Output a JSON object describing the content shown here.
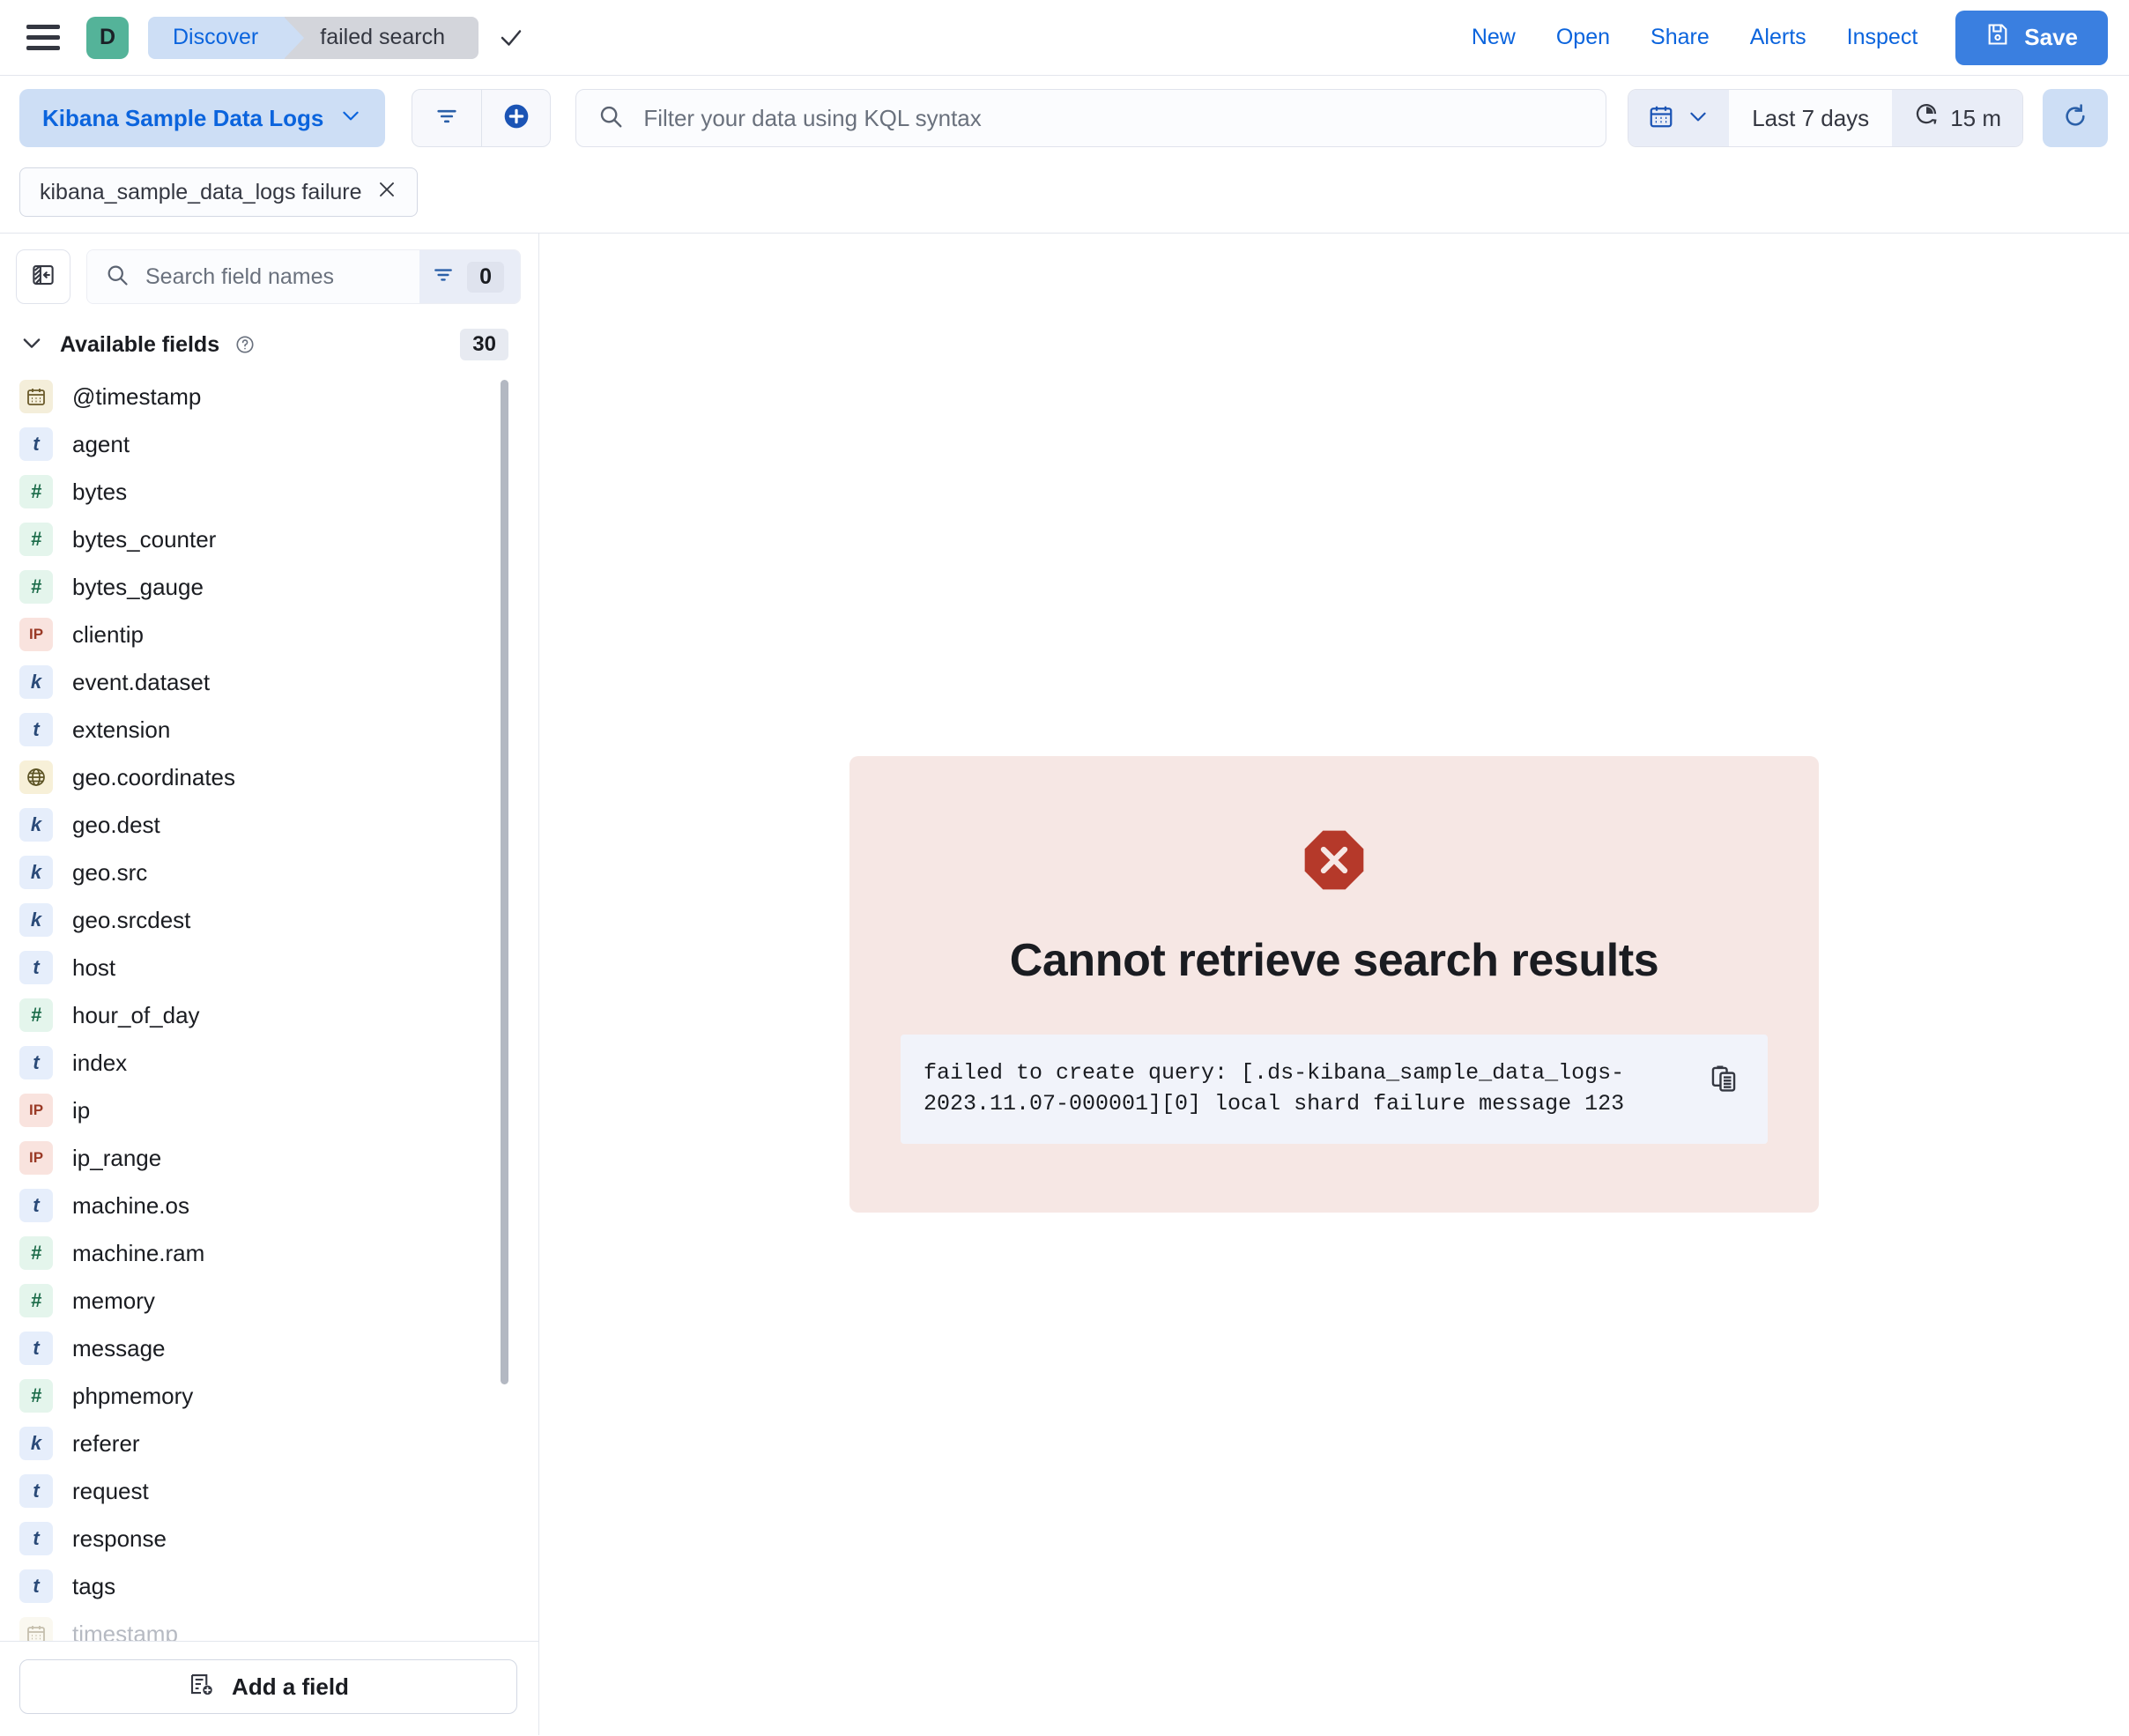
{
  "chrome": {
    "menu_icon": "hamburger-icon",
    "space_initial": "D",
    "breadcrumbs": [
      {
        "label": "Discover",
        "icon": ""
      },
      {
        "label": "failed search",
        "icon": ""
      }
    ],
    "saved_check_icon": "check-icon",
    "links": [
      "New",
      "Open",
      "Share",
      "Alerts",
      "Inspect"
    ],
    "save_label": "Save",
    "save_icon": "save-disk-icon",
    "accent_blue": "#0b64dd",
    "save_bg": "#3a7fe0",
    "space_bg": "#54b399"
  },
  "query": {
    "data_view": "Kibana Sample Data Logs",
    "data_view_chevron": "chevron-down-icon",
    "filter_icon": "filter-icon",
    "add_filter_icon": "plus-circle-icon",
    "search_icon": "search-icon",
    "kql_placeholder": "Filter your data using KQL syntax",
    "kql_value": "",
    "calendar_icon": "calendar-icon",
    "calendar_chevron": "chevron-down-icon",
    "time_range": "Last 7 days",
    "refresh_interval_icon": "clock-icon",
    "refresh_interval": "15 m",
    "refresh_icon": "refresh-icon"
  },
  "filters": [
    {
      "label": "kibana_sample_data_logs failure",
      "remove_icon": "close-icon"
    }
  ],
  "sidebar": {
    "collapse_icon": "collapse-sidebar-icon",
    "search_icon": "search-icon",
    "search_placeholder": "Search field names",
    "search_value": "",
    "field_filter_icon": "filter-icon",
    "field_filter_count": "0",
    "available_label": "Available fields",
    "available_help_icon": "help-circle-icon",
    "available_count": "30",
    "collapse_chevron": "chevron-down-icon",
    "fields": [
      {
        "name": "@timestamp",
        "type": "date",
        "glyph": "date-icon",
        "faded": false
      },
      {
        "name": "agent",
        "type": "t",
        "glyph": "t",
        "faded": false
      },
      {
        "name": "bytes",
        "type": "n",
        "glyph": "#",
        "faded": false
      },
      {
        "name": "bytes_counter",
        "type": "n",
        "glyph": "#",
        "faded": false
      },
      {
        "name": "bytes_gauge",
        "type": "n",
        "glyph": "#",
        "faded": false
      },
      {
        "name": "clientip",
        "type": "ip",
        "glyph": "IP",
        "faded": false
      },
      {
        "name": "event.dataset",
        "type": "k",
        "glyph": "k",
        "faded": false
      },
      {
        "name": "extension",
        "type": "t",
        "glyph": "t",
        "faded": false
      },
      {
        "name": "geo.coordinates",
        "type": "geo",
        "glyph": "geo-icon",
        "faded": false
      },
      {
        "name": "geo.dest",
        "type": "k",
        "glyph": "k",
        "faded": false
      },
      {
        "name": "geo.src",
        "type": "k",
        "glyph": "k",
        "faded": false
      },
      {
        "name": "geo.srcdest",
        "type": "k",
        "glyph": "k",
        "faded": false
      },
      {
        "name": "host",
        "type": "t",
        "glyph": "t",
        "faded": false
      },
      {
        "name": "hour_of_day",
        "type": "n",
        "glyph": "#",
        "faded": false
      },
      {
        "name": "index",
        "type": "t",
        "glyph": "t",
        "faded": false
      },
      {
        "name": "ip",
        "type": "ip",
        "glyph": "IP",
        "faded": false
      },
      {
        "name": "ip_range",
        "type": "ip",
        "glyph": "IP",
        "faded": false
      },
      {
        "name": "machine.os",
        "type": "t",
        "glyph": "t",
        "faded": false
      },
      {
        "name": "machine.ram",
        "type": "n",
        "glyph": "#",
        "faded": false
      },
      {
        "name": "memory",
        "type": "n",
        "glyph": "#",
        "faded": false
      },
      {
        "name": "message",
        "type": "t",
        "glyph": "t",
        "faded": false
      },
      {
        "name": "phpmemory",
        "type": "n",
        "glyph": "#",
        "faded": false
      },
      {
        "name": "referer",
        "type": "k",
        "glyph": "k",
        "faded": false
      },
      {
        "name": "request",
        "type": "t",
        "glyph": "t",
        "faded": false
      },
      {
        "name": "response",
        "type": "t",
        "glyph": "t",
        "faded": false
      },
      {
        "name": "tags",
        "type": "t",
        "glyph": "t",
        "faded": false
      },
      {
        "name": "timestamp",
        "type": "date",
        "glyph": "date-icon",
        "faded": true
      }
    ],
    "add_field_label": "Add a field",
    "add_field_icon": "add-field-icon"
  },
  "error": {
    "icon": "error-octagon-icon",
    "icon_color": "#b5392a",
    "panel_bg": "#f6e7e4",
    "title": "Cannot retrieve search results",
    "message": "failed to create query: [.ds-kibana_sample_data_logs-2023.11.07-000001][0] local shard failure message 123",
    "copy_icon": "copy-clipboard-icon"
  }
}
